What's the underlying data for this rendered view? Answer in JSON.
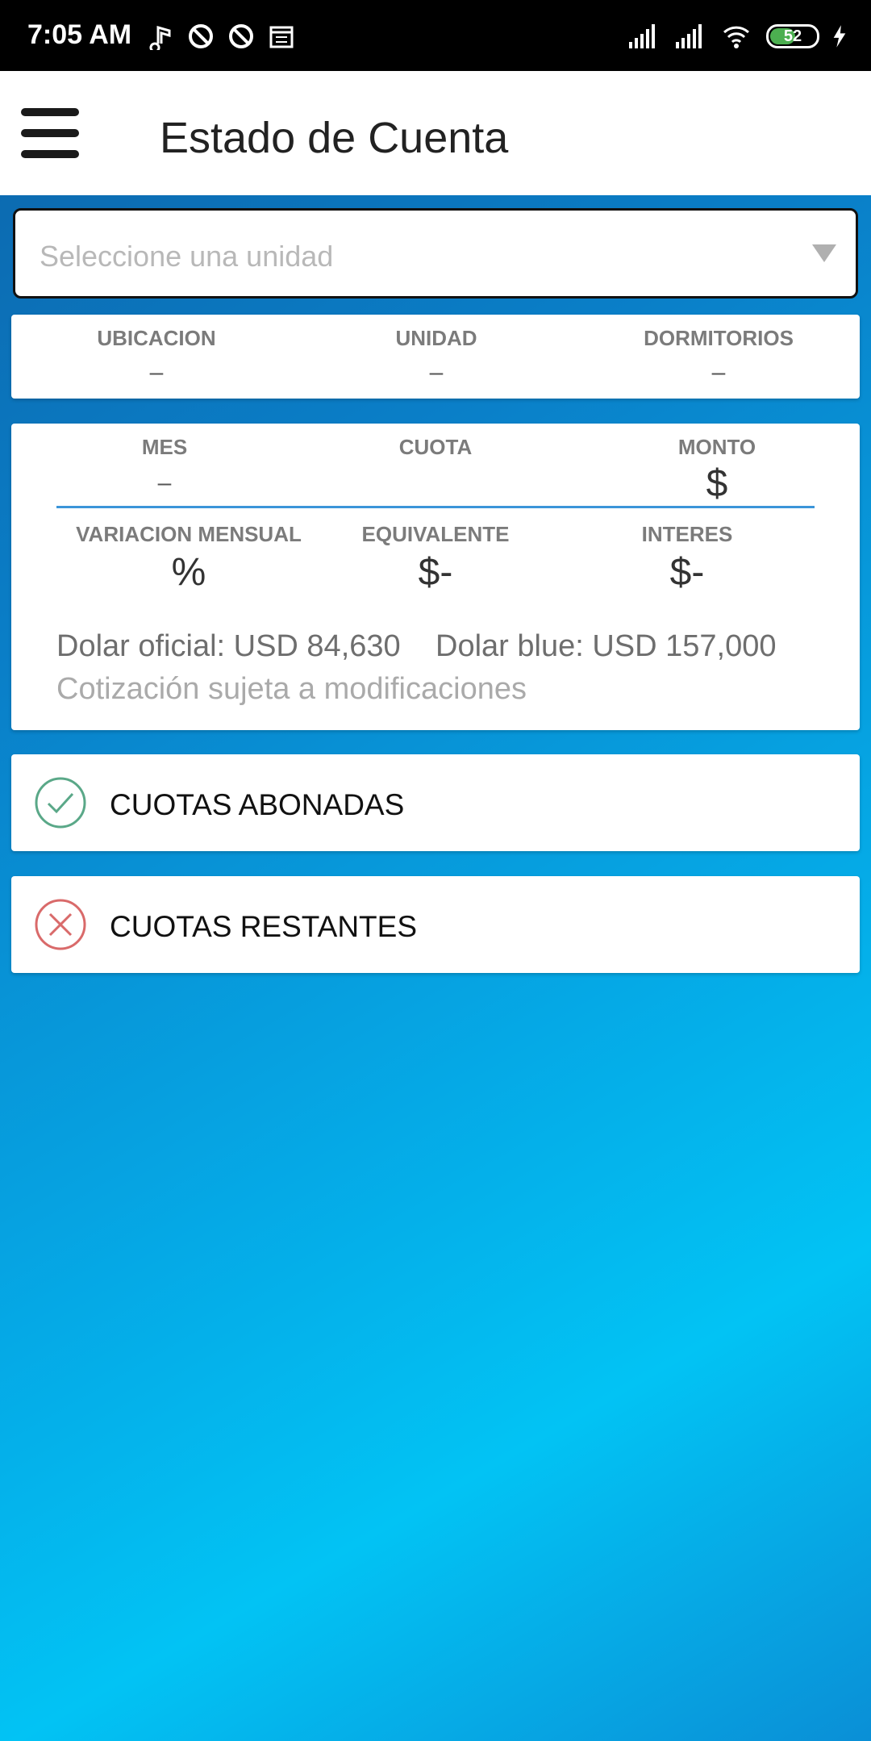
{
  "status_bar": {
    "time": "7:05 AM",
    "battery": "52"
  },
  "app_bar": {
    "title": "Estado de Cuenta"
  },
  "unit_select": {
    "placeholder": "Seleccione una unidad"
  },
  "unit_info": {
    "columns": [
      {
        "label": "UBICACION",
        "value": "–"
      },
      {
        "label": "UNIDAD",
        "value": "–"
      },
      {
        "label": "DORMITORIOS",
        "value": "–"
      }
    ]
  },
  "details": {
    "row1": [
      {
        "label": "MES",
        "value": "–"
      },
      {
        "label": "CUOTA",
        "value": ""
      },
      {
        "label": "MONTO",
        "value": "$"
      }
    ],
    "row2": [
      {
        "label": "VARIACION MENSUAL",
        "value": "%"
      },
      {
        "label": "EQUIVALENTE",
        "value": "$-"
      },
      {
        "label": "INTERES",
        "value": "$-"
      }
    ],
    "dolar_oficial": "Dolar oficial: USD 84,630",
    "dolar_blue": "Dolar blue: USD 157,000",
    "note": "Cotización sujeta a modificaciones"
  },
  "cuotas": {
    "paid_label": "CUOTAS ABONADAS",
    "remaining_label": "CUOTAS RESTANTES"
  },
  "colors": {
    "accent": "#3b95d9",
    "paid_icon": "#5aa888",
    "remaining_icon": "#d96a6a"
  }
}
